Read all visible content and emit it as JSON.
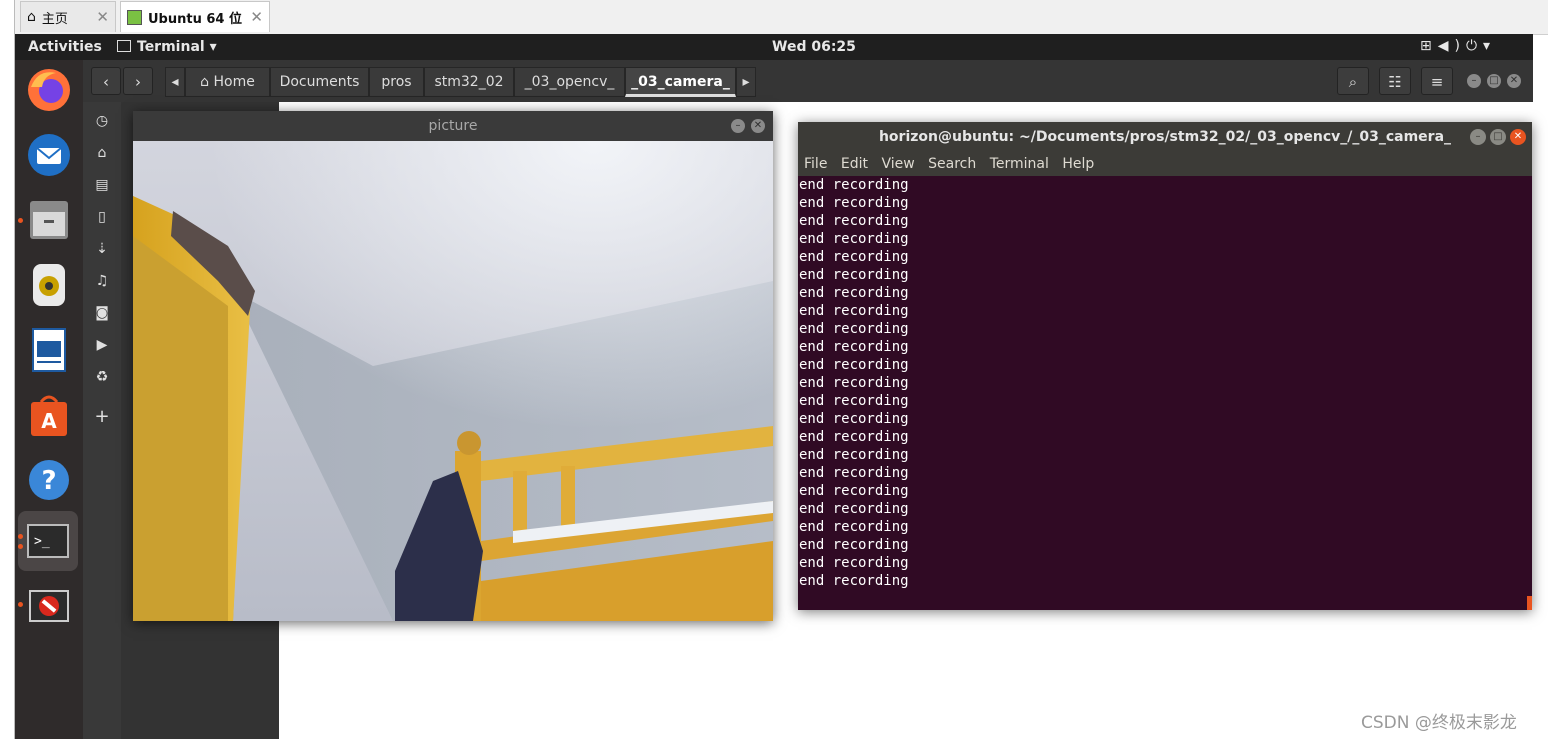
{
  "host": {
    "tabs": [
      {
        "label": "主页",
        "icon": "home-icon"
      },
      {
        "label": "Ubuntu 64 位",
        "icon": "vm-icon"
      }
    ]
  },
  "topbar": {
    "activities": "Activities",
    "app_menu": "Terminal ▾",
    "clock": "Wed 06:25",
    "tray_icons": [
      "network-icon",
      "volume-icon",
      "power-icon",
      "chevron-down-icon"
    ]
  },
  "dock": {
    "items": [
      "firefox-icon",
      "thunderbird-icon",
      "files-icon",
      "rhythmbox-icon",
      "writer-icon",
      "software-icon",
      "help-icon",
      "terminal-icon",
      "disabled-app-icon"
    ]
  },
  "files": {
    "breadcrumbs": [
      "Home",
      "Documents",
      "pros",
      "stm32_02",
      "_03_opencv_",
      "_03_camera_"
    ],
    "sidebar_icons": [
      "recent-icon",
      "home-icon",
      "documents-icon",
      "file-icon",
      "downloads-icon",
      "music-icon",
      "camera-icon",
      "video-icon",
      "trash-icon",
      "add-icon"
    ]
  },
  "picture_window": {
    "title": "picture"
  },
  "terminal": {
    "title": "horizon@ubuntu: ~/Documents/pros/stm32_02/_03_opencv_/_03_camera_",
    "menu": [
      "File",
      "Edit",
      "View",
      "Search",
      "Terminal",
      "Help"
    ],
    "lines": [
      "end recording",
      "end recording",
      "end recording",
      "end recording",
      "end recording",
      "end recording",
      "end recording",
      "end recording",
      "end recording",
      "end recording",
      "end recording",
      "end recording",
      "end recording",
      "end recording",
      "end recording",
      "end recording",
      "end recording",
      "end recording",
      "end recording",
      "end recording",
      "end recording",
      "end recording",
      "end recording"
    ]
  },
  "watermark": "CSDN @终极末影龙",
  "colors": {
    "terminal_bg": "#300a24",
    "ubuntu_orange": "#e95420",
    "dock_bg": "#2f2b2b"
  }
}
